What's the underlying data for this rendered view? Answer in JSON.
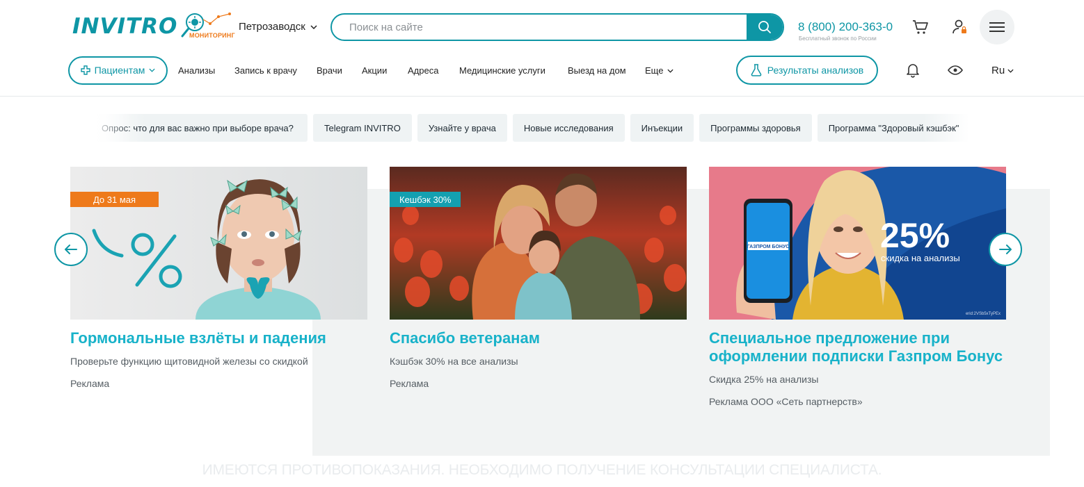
{
  "header": {
    "logo_text": "INVITRO",
    "monitoring_label": "МОНИТОРИНГ",
    "city": "Петрозаводск",
    "search_placeholder": "Поиск на сайте",
    "phone": "8 (800) 200-363-0",
    "phone_note": "Бесплатный звонок по России"
  },
  "nav": {
    "patients": "Пациентам",
    "links": [
      "Анализы",
      "Запись к врачу",
      "Врачи",
      "Акции",
      "Адреса",
      "Медицинские услуги",
      "Выезд на дом",
      "Еще"
    ],
    "results_button": "Результаты анализов",
    "language": "Ru"
  },
  "chips": [
    "Опрос: что для вас важно при выборе врача?",
    "Telegram INVITRO",
    "Узнайте у врача",
    "Новые исследования",
    "Инъекции",
    "Программы здоровья",
    "Программа \"Здоровый кэшбэк\""
  ],
  "cards": [
    {
      "badge": "До 31 мая",
      "title": "Гормональные взлёты и падения",
      "desc": "Проверьте функцию щитовидной железы со скидкой",
      "ad": "Реклама"
    },
    {
      "badge": "Кешбэк 30%",
      "title": "Спасибо ветеранам",
      "desc": "Кэшбэк 30% на все анализы",
      "ad": "Реклама"
    },
    {
      "title": "Специальное предложение при оформлении подписки Газпром Бонус",
      "desc": "Скидка 25% на анализы",
      "ad": "Реклама ООО «Сеть партнерств»",
      "promo_big": "25%",
      "promo_small": "скидка на анализы",
      "phone_brand": "ГАЗПРОМ БОНУС",
      "erid": "erid:2VSb5xTyPEx"
    }
  ],
  "disclaimer": "ИМЕЮТСЯ ПРОТИВОПОКАЗАНИЯ. НЕОБХОДИМО ПОЛУЧЕНИЕ КОНСУЛЬТАЦИИ СПЕЦИАЛИСТА.",
  "colors": {
    "brand": "#0e96a5",
    "title": "#18b2c9",
    "accent_orange": "#ee7a1b"
  }
}
